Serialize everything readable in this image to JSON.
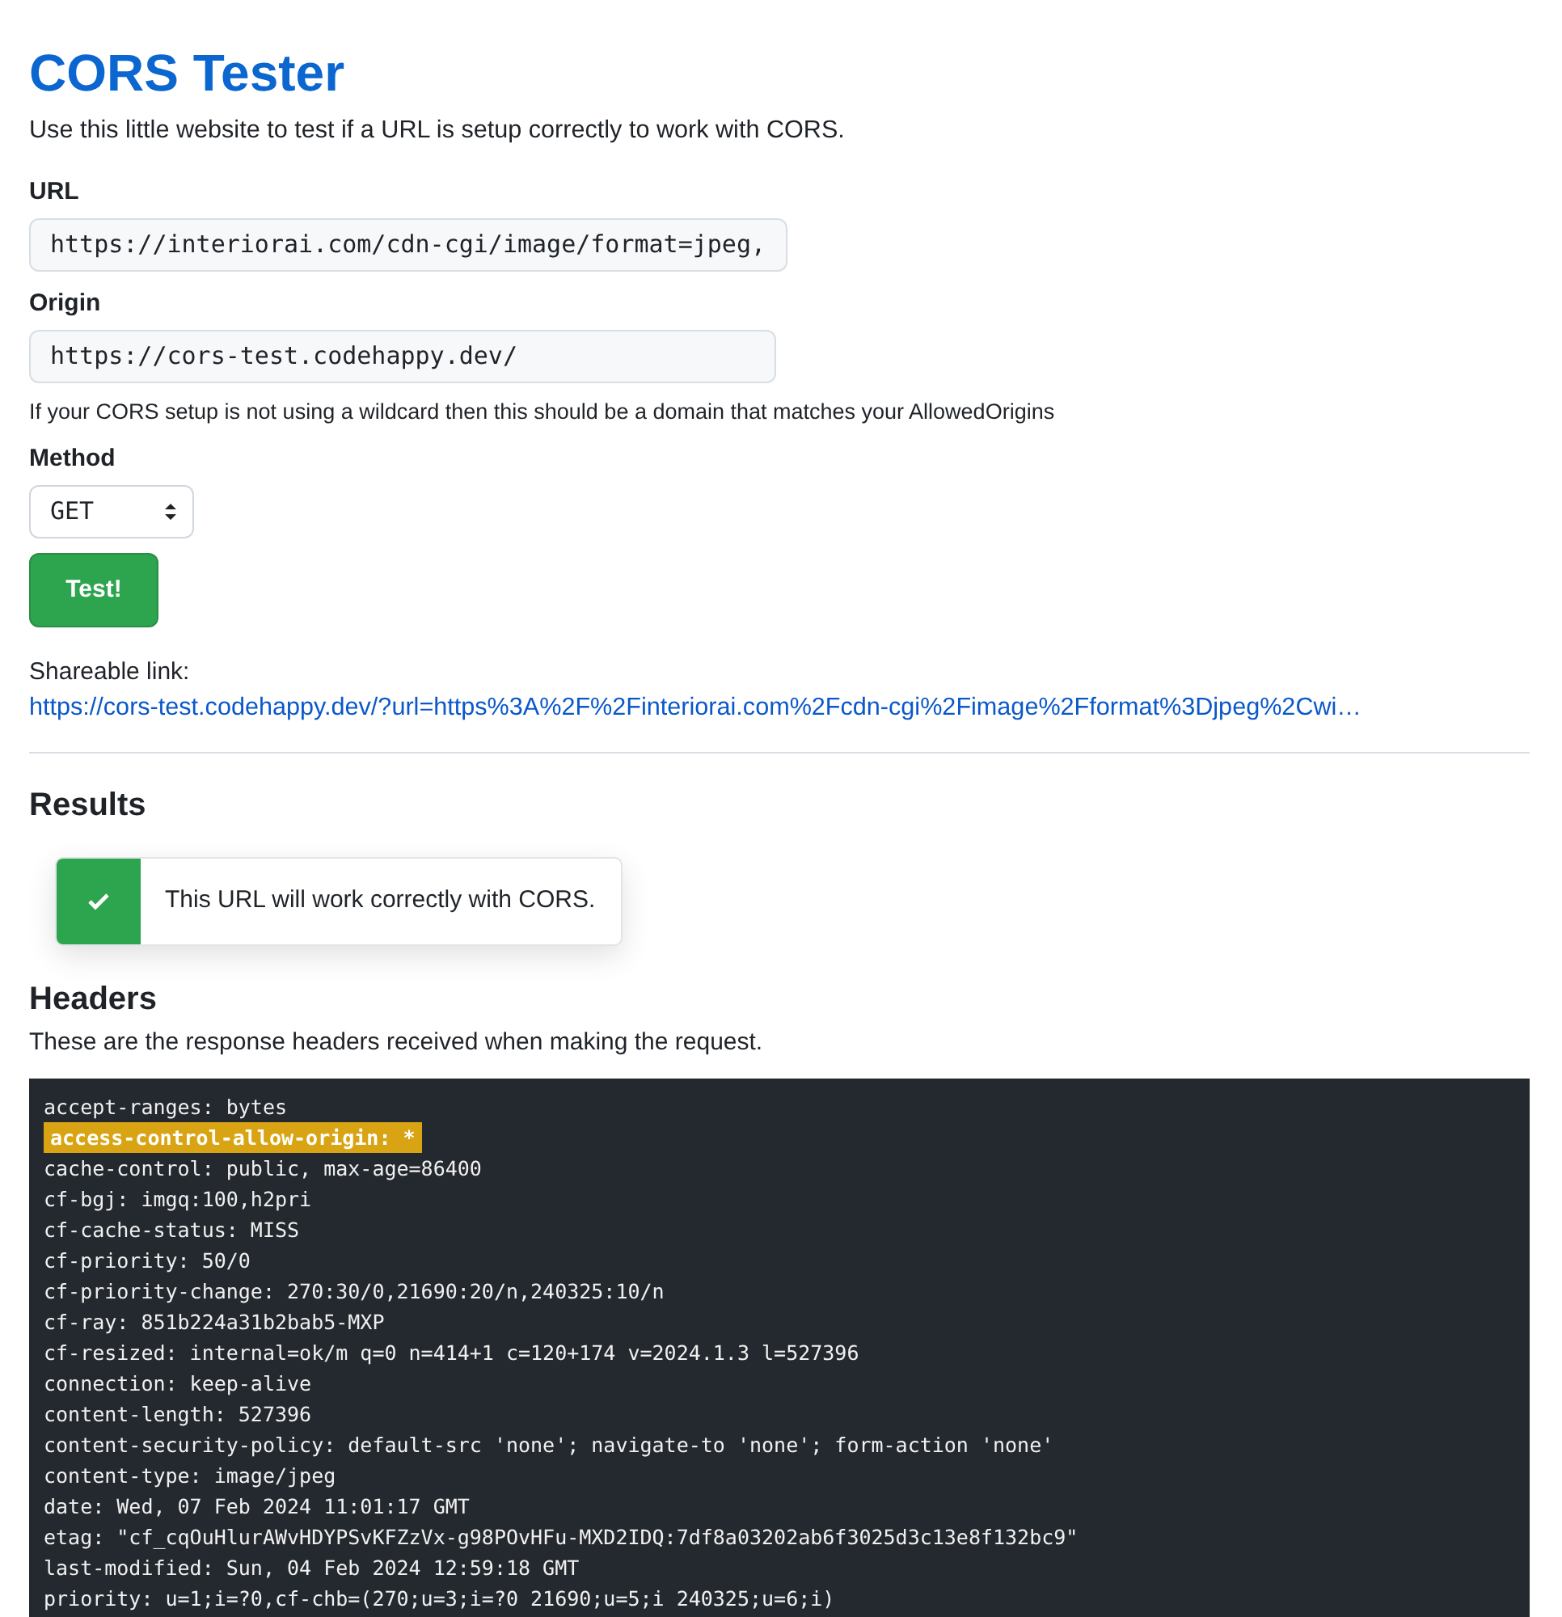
{
  "page": {
    "title": "CORS Tester",
    "description": "Use this little website to test if a URL is setup correctly to work with CORS."
  },
  "form": {
    "fields": [
      {
        "kind": "text",
        "label": "URL",
        "value": "https://interiorai.com/cdn-cgi/image/format=jpeg,"
      },
      {
        "kind": "text",
        "label": "Origin",
        "value": "https://cors-test.codehappy.dev/",
        "hint": "If your CORS setup is not using a wildcard then this should be a domain that matches your AllowedOrigins"
      },
      {
        "kind": "select",
        "label": "Method",
        "value": "GET"
      }
    ],
    "submit_button": "Test!"
  },
  "share": {
    "label": "Shareable link:",
    "link": "https://cors-test.codehappy.dev/?url=https%3A%2F%2Finteriorai.com%2Fcdn-cgi%2Fimage%2Fformat%3Djpeg%2Cwi…"
  },
  "results": {
    "heading": "Results",
    "alert": {
      "passed": true,
      "message": "This URL will work correctly with CORS."
    }
  },
  "headers": {
    "heading": "Headers",
    "description": "These are the response headers received when making the request.",
    "lines": [
      {
        "text": "accept-ranges: bytes",
        "highlighted": false
      },
      {
        "text": "access-control-allow-origin: *",
        "highlighted": true
      },
      {
        "text": "cache-control: public, max-age=86400",
        "highlighted": false
      },
      {
        "text": "cf-bgj: imgq:100,h2pri",
        "highlighted": false
      },
      {
        "text": "cf-cache-status: MISS",
        "highlighted": false
      },
      {
        "text": "cf-priority: 50/0",
        "highlighted": false
      },
      {
        "text": "cf-priority-change: 270:30/0,21690:20/n,240325:10/n",
        "highlighted": false
      },
      {
        "text": "cf-ray: 851b224a31b2bab5-MXP",
        "highlighted": false
      },
      {
        "text": "cf-resized: internal=ok/m q=0 n=414+1 c=120+174 v=2024.1.3 l=527396",
        "highlighted": false
      },
      {
        "text": "connection: keep-alive",
        "highlighted": false
      },
      {
        "text": "content-length: 527396",
        "highlighted": false
      },
      {
        "text": "content-security-policy: default-src 'none'; navigate-to 'none'; form-action 'none'",
        "highlighted": false
      },
      {
        "text": "content-type: image/jpeg",
        "highlighted": false
      },
      {
        "text": "date: Wed, 07 Feb 2024 11:01:17 GMT",
        "highlighted": false
      },
      {
        "text": "etag: \"cf_cqOuHlurAWvHDYPSvKFZzVx-g98POvHFu-MXD2IDQ:7df8a03202ab6f3025d3c13e8f132bc9\"",
        "highlighted": false
      },
      {
        "text": "last-modified: Sun, 04 Feb 2024 12:59:18 GMT",
        "highlighted": false
      },
      {
        "text": "priority: u=1;i=?0,cf-chb=(270;u=3;i=?0 21690;u=5;i 240325;u=6;i)",
        "highlighted": false
      }
    ]
  }
}
